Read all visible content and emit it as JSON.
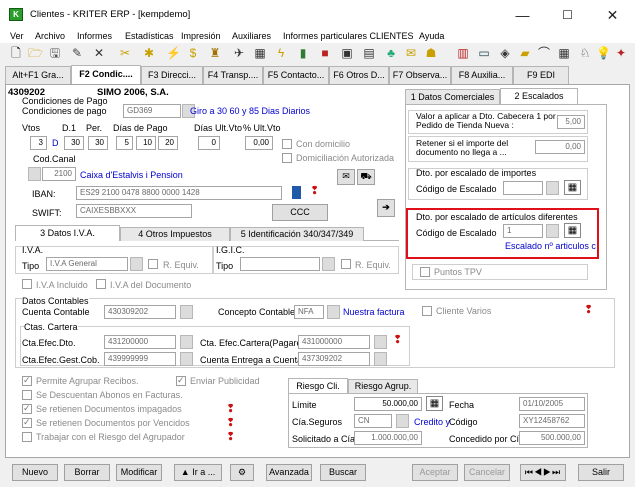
{
  "window": {
    "title": "Clientes - KRITER ERP - [kempdemo]",
    "minimize": "—",
    "maximize": "☐",
    "close": "✕"
  },
  "menu": [
    "Ver",
    "Archivo",
    "Informes",
    "Estadísticas",
    "Impresión",
    "Auxiliares",
    "Informes particulares CLIENTES",
    "Ayuda"
  ],
  "tabs": [
    "Alt+F1 Gra...",
    "F2 Condic....",
    "F3 Direcci...",
    "F4 Transp....",
    "F5 Contacto...",
    "F6 Otros D...",
    "F7 Observa...",
    "F8 Auxilia...",
    "F9 EDI"
  ],
  "client": {
    "code": "4309202",
    "name": "SIMO 2006, S.A."
  },
  "condiciones": {
    "section_label": "Condiciones de Pago",
    "label": "Condiciones de pago",
    "code": "GD369",
    "desc": "Giro a 30 60 y 85 Dias Diarios",
    "col_vtos": "Vtos",
    "col_d1": "D.1",
    "col_per": "Per.",
    "col_dias": "Días de Pago",
    "col_dias_ult": "Días Ult.Vto",
    "col_pct": "% Ult.Vto",
    "vtos": "3",
    "d1": "D",
    "d1_val": "30",
    "per": "30",
    "dias": [
      "5",
      "10",
      "20"
    ],
    "dias_ult": "0",
    "pct": "0,00",
    "con_domicilio": "Con domicilio",
    "domiciliacion": "Domiciliación Autorizada"
  },
  "banco": {
    "canal_label": "Cod.Canal",
    "canal_code": "2100",
    "canal_desc": "Caixa d'Estalvis i Pension",
    "iban_label": "IBAN:",
    "iban": "ES29 2100 0478 8800 0000 1428",
    "swift_label": "SWIFT:",
    "swift": "CAIXESBBXXX",
    "ccc_button": "CCC"
  },
  "inner_tabs": [
    "3 Datos I.V.A.",
    "4 Otros Impuestos",
    "5 Identificación 340/347/349"
  ],
  "iva": {
    "iva_label": "I.V.A.",
    "tipo_label": "Tipo",
    "tipo": "I.V.A General",
    "r_equiv": "R. Equiv.",
    "igic_label": "I.G.I.C.",
    "igic_tipo_label": "Tipo",
    "igic_r_equiv": "R. Equiv.",
    "iva_incluido": "I.V.A Incluido",
    "iva_documento": "I.V.A del Documento"
  },
  "right_tabs": [
    "1 Datos Comerciales",
    "2 Escalados"
  ],
  "escalados": {
    "valor_label": "Valor a aplicar a Dto. Cabecera 1 por Pedido de Tienda Nueva :",
    "valor": "5,00",
    "retener_label": "Retener si el importe del documento no llega a ...",
    "retener": "0,00",
    "importes_title": "Dto. por escalado de importes",
    "importes_code_label": "Código de Escalado",
    "articulos_title": "Dto. por escalado de artículos diferentes",
    "articulos_code_label": "Código de Escalado",
    "articulos_code": "1",
    "articulos_desc": "Escalado nº articulos c",
    "puntos_tpv": "Puntos TPV"
  },
  "contables": {
    "title": "Datos Contables",
    "cuenta_label": "Cuenta Contable",
    "cuenta": "430309202",
    "concepto_label": "Concepto Contable",
    "concepto": "NFA",
    "concepto_desc": "Nuestra factura",
    "cliente_varios": "Cliente Varios",
    "cartera_title": "Ctas. Cartera",
    "efec_dto_label": "Cta.Efec.Dto.",
    "efec_dto": "431200000",
    "efec_gest_label": "Cta.Efec.Gest.Cob.",
    "efec_gest": "439999999",
    "efec_pagare_label": "Cta. Efec.Cartera(Pagaré)",
    "efec_pagare": "431000000",
    "entrega_label": "Cuenta Entrega a Cuenta",
    "entrega": "437309202"
  },
  "checks": {
    "agrupar": "Permite Agrupar Recibos.",
    "publicidad": "Enviar Publicidad",
    "descuentan": "Se Descuentan Abonos en Facturas.",
    "impagados": "Se retienen Documentos impagados",
    "vencidos": "Se retienen Documentos por Vencidos",
    "agrupador": "Trabajar con el Riesgo del Agrupador"
  },
  "riesgo": {
    "tab1": "Riesgo Cli.",
    "tab2": "Riesgo Agrup.",
    "limite_label": "Límite",
    "limite": "50.000,00",
    "fecha_label": "Fecha",
    "fecha": "01/10/2005",
    "seguros_label": "Cía.Seguros",
    "seguros": "CN",
    "seguros_desc": "Credito y",
    "codigo_label": "Código",
    "codigo": "XY12458762",
    "solicitado_label": "Solicitado a Cía",
    "solicitado": "1.000.000,00",
    "concedido_label": "Concedido por Cía",
    "concedido": "500.000,00"
  },
  "bottom": {
    "nuevo": "Nuevo",
    "borrar": "Borrar",
    "modificar": "Modificar",
    "ir": "▲ Ir a ...",
    "avanzada": "Avanzada",
    "buscar": "Buscar",
    "aceptar": "Aceptar",
    "cancelar": "Cancelar",
    "salir": "Salir"
  }
}
